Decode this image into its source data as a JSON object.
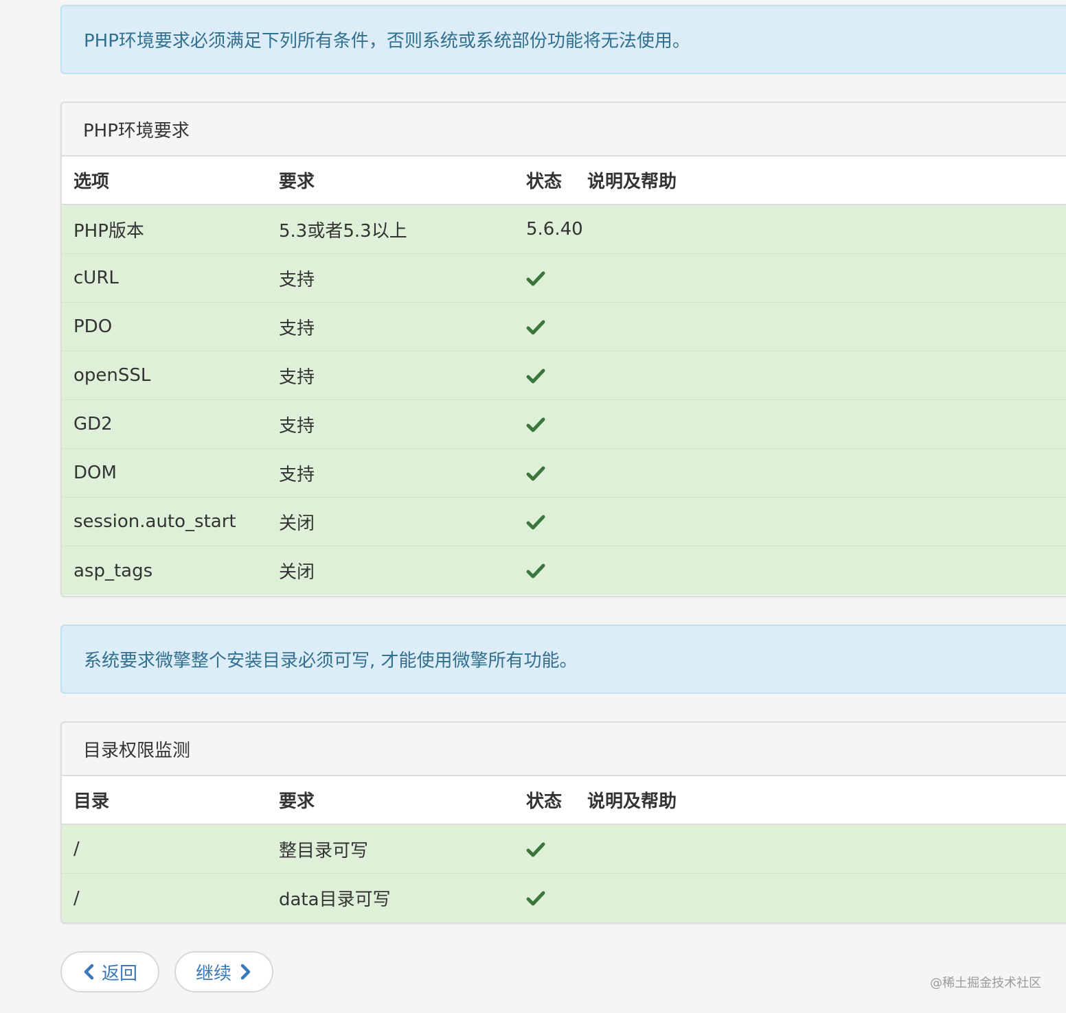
{
  "alerts": {
    "php_env": "PHP环境要求必须满足下列所有条件，否则系统或系统部份功能将无法使用。",
    "dir_writable": "系统要求微擎整个安装目录必须可写, 才能使用微擎所有功能。"
  },
  "php_panel": {
    "title": "PHP环境要求",
    "headers": [
      "选项",
      "要求",
      "状态",
      "说明及帮助"
    ],
    "rows": [
      {
        "option": "PHP版本",
        "requirement": "5.3或者5.3以上",
        "status": "5.6.40",
        "ok": false
      },
      {
        "option": "cURL",
        "requirement": "支持",
        "status": "",
        "ok": true
      },
      {
        "option": "PDO",
        "requirement": "支持",
        "status": "",
        "ok": true
      },
      {
        "option": "openSSL",
        "requirement": "支持",
        "status": "",
        "ok": true
      },
      {
        "option": "GD2",
        "requirement": "支持",
        "status": "",
        "ok": true
      },
      {
        "option": "DOM",
        "requirement": "支持",
        "status": "",
        "ok": true
      },
      {
        "option": "session.auto_start",
        "requirement": "关闭",
        "status": "",
        "ok": true
      },
      {
        "option": "asp_tags",
        "requirement": "关闭",
        "status": "",
        "ok": true
      }
    ]
  },
  "dir_panel": {
    "title": "目录权限监测",
    "headers": [
      "目录",
      "要求",
      "状态",
      "说明及帮助"
    ],
    "rows": [
      {
        "option": "/",
        "requirement": "整目录可写",
        "status": "",
        "ok": true
      },
      {
        "option": "/",
        "requirement": "data目录可写",
        "status": "",
        "ok": true
      }
    ]
  },
  "buttons": {
    "back": "返回",
    "next": "继续"
  },
  "icons": {
    "check": "check-icon",
    "back": "chevron-left-icon",
    "next": "chevron-right-icon"
  },
  "colors": {
    "success_row": "#dff0d8",
    "check": "#3c763d",
    "info_bg": "#dcedf8",
    "info_text": "#31708f",
    "link": "#3a78b8"
  },
  "watermark": "@稀土掘金技术社区"
}
